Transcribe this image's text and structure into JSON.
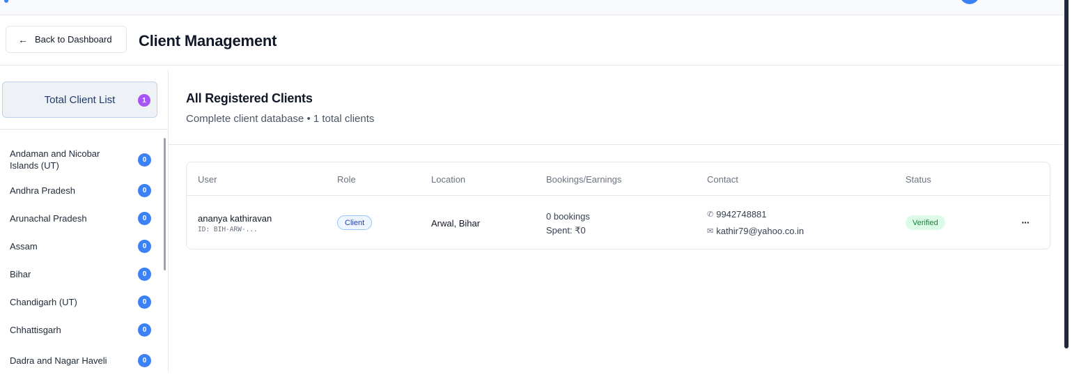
{
  "header": {
    "back_label": "Back to Dashboard",
    "title": "Client Management"
  },
  "sidebar": {
    "total_label": "Total Client List",
    "total_count": "1",
    "states": [
      {
        "name": "Andaman and Nicobar Islands (UT)",
        "count": "0"
      },
      {
        "name": "Andhra Pradesh",
        "count": "0"
      },
      {
        "name": "Arunachal Pradesh",
        "count": "0"
      },
      {
        "name": "Assam",
        "count": "0"
      },
      {
        "name": "Bihar",
        "count": "0"
      },
      {
        "name": "Chandigarh (UT)",
        "count": "0"
      },
      {
        "name": "Chhattisgarh",
        "count": "0"
      },
      {
        "name": "Dadra and Nagar Haveli",
        "count": "0"
      }
    ]
  },
  "main": {
    "title": "All Registered Clients",
    "subtitle": "Complete client database • 1 total clients",
    "columns": [
      "User",
      "Role",
      "Location",
      "Bookings/Earnings",
      "Contact",
      "Status"
    ],
    "rows": [
      {
        "name": "ananya kathiravan",
        "id": "ID: BIH-ARW-...",
        "role": "Client",
        "location": "Arwal, Bihar",
        "bookings": "0 bookings",
        "spent": "Spent: ₹0",
        "phone": "9942748881",
        "email": "kathir79@yahoo.co.in",
        "status": "Verified",
        "more": "···"
      }
    ]
  },
  "icons": {
    "back": "arrow-left-icon",
    "phone": "phone-icon",
    "email": "mail-icon",
    "more": "more-horizontal-icon"
  },
  "colors": {
    "accent": "#3b82f6",
    "total_badge": "#a855f7",
    "verified_bg": "#dcfce7",
    "verified_text": "#15803d"
  }
}
